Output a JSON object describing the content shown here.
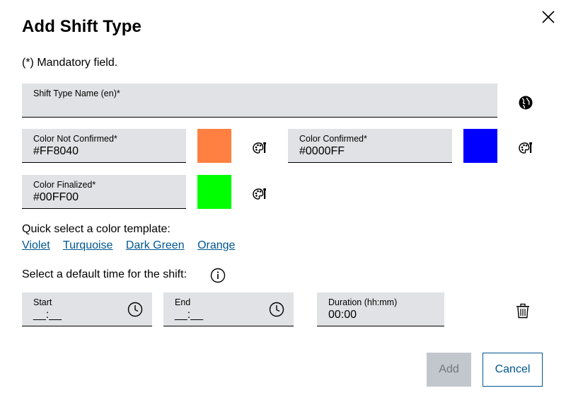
{
  "dialog": {
    "title": "Add Shift Type",
    "mandatory_note": "(*) Mandatory field.",
    "close_icon": "close-icon"
  },
  "name_field": {
    "label": "Shift Type Name (en)*",
    "value": "",
    "language_icon": "globe-icon"
  },
  "colors": {
    "not_confirmed": {
      "label": "Color Not Confirmed*",
      "value": "#FF8040",
      "swatch": "#FF8040"
    },
    "confirmed": {
      "label": "Color Confirmed*",
      "value": "#0000FF",
      "swatch": "#0000FF"
    },
    "finalized": {
      "label": "Color Finalized*",
      "value": "#00FF00",
      "swatch": "#00FF00"
    },
    "picker_icon": "color-palette-icon"
  },
  "template": {
    "prompt": "Quick select a color template:",
    "options": [
      "Violet",
      "Turquoise",
      "Dark Green",
      "Orange"
    ]
  },
  "time": {
    "prompt": "Select a default time for the shift:",
    "start": {
      "label": "Start",
      "value": "__:__"
    },
    "end": {
      "label": "End",
      "value": "__:__"
    },
    "duration": {
      "label": "Duration (hh:mm)",
      "value": "00:00"
    }
  },
  "actions": {
    "add_label": "Add",
    "cancel_label": "Cancel"
  },
  "palette": {
    "accent": "#005691",
    "field_bg": "#E0E2E5",
    "disabled_bg": "#C1C7CC"
  }
}
